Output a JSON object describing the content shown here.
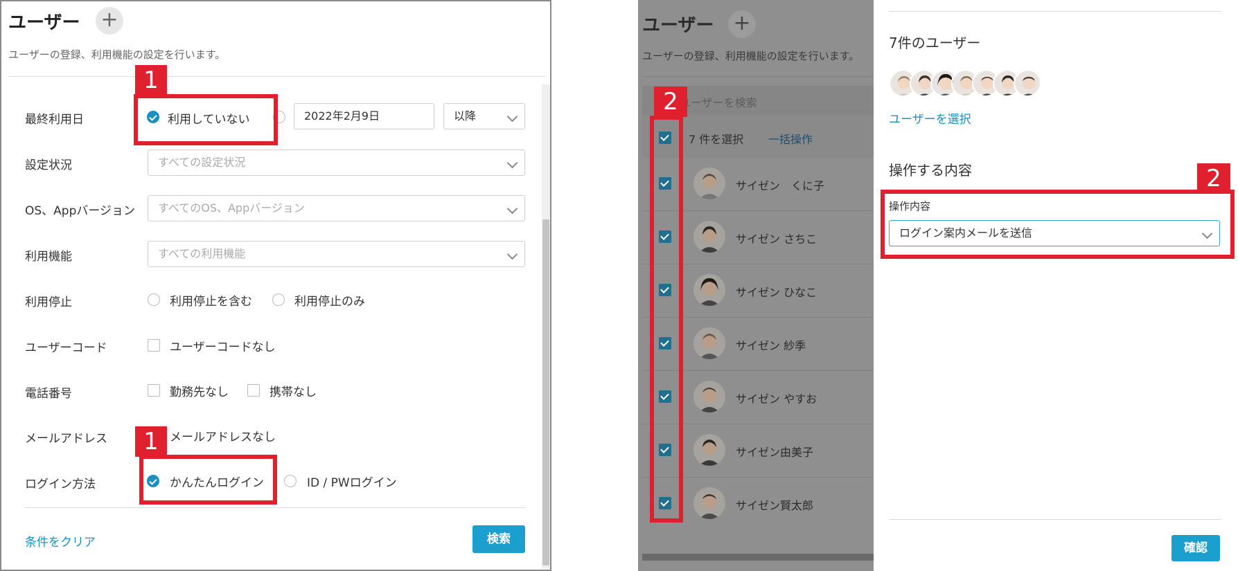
{
  "left": {
    "title": "ユーザー",
    "description": "ユーザーの登録、利用機能の設定を行います。",
    "filters": {
      "last_used": {
        "label": "最終利用日",
        "option_not_used": "利用していない",
        "date_value": "2022年2月9日",
        "direction": "以降"
      },
      "setting_status": {
        "label": "設定状況",
        "placeholder": "すべての設定状況"
      },
      "os_version": {
        "label": "OS、Appバージョン",
        "placeholder": "すべてのOS、Appバージョン"
      },
      "features": {
        "label": "利用機能",
        "placeholder": "すべての利用機能"
      },
      "suspended": {
        "label": "利用停止",
        "option_include": "利用停止を含む",
        "option_only": "利用停止のみ"
      },
      "user_code": {
        "label": "ユーザーコード",
        "option_none": "ユーザーコードなし"
      },
      "phone": {
        "label": "電話番号",
        "option_work_none": "勤務先なし",
        "option_mobile_none": "携帯なし"
      },
      "email": {
        "label": "メールアドレス",
        "option_none": "メールアドレスなし"
      },
      "login": {
        "label": "ログイン方法",
        "option_easy": "かんたんログイン",
        "option_idpw": "ID / PWログイン"
      }
    },
    "clear_link": "条件をクリア",
    "search_button": "検索"
  },
  "right": {
    "title": "ユーザー",
    "description": "ユーザーの登録、利用機能の設定を行います。",
    "search_placeholder": "ユーザーを検索",
    "selected_count": "7 件を選択",
    "bulk_action": "一括操作",
    "users": [
      {
        "name": "サイゼン　くに子"
      },
      {
        "name": "サイゼン さちこ"
      },
      {
        "name": "サイゼン ひなこ"
      },
      {
        "name": "サイゼン 紗季"
      },
      {
        "name": "サイゼン やすお"
      },
      {
        "name": "サイゼン由美子"
      },
      {
        "name": "サイゼン賢太郎"
      }
    ],
    "drawer": {
      "users_heading": "7件のユーザー",
      "select_users_link": "ユーザーを選択",
      "operation_heading": "操作する内容",
      "operation_label": "操作内容",
      "operation_value": "ログイン案内メールを送信",
      "confirm_button": "確認"
    }
  },
  "annotations": {
    "tag_1": "1",
    "tag_2": "2"
  },
  "colors": {
    "accent": "#1a8fc0",
    "highlight": "#e0202e",
    "button": "#1a9fcf"
  }
}
